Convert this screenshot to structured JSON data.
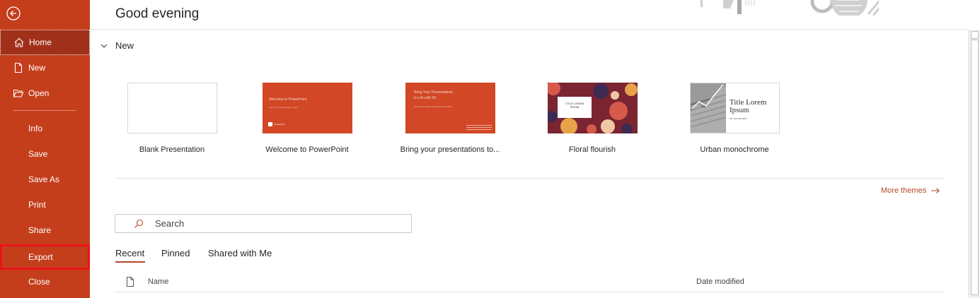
{
  "sidebar": {
    "back_icon": "back-arrow-circle-icon",
    "items": [
      {
        "label": "Home",
        "icon": "home-icon"
      },
      {
        "label": "New",
        "icon": "new-document-icon"
      },
      {
        "label": "Open",
        "icon": "folder-open-icon"
      },
      {
        "label": "Info"
      },
      {
        "label": "Save"
      },
      {
        "label": "Save As"
      },
      {
        "label": "Print"
      },
      {
        "label": "Share"
      },
      {
        "label": "Export"
      },
      {
        "label": "Close"
      }
    ],
    "selected": "Home",
    "highlighted": "Export",
    "colors": {
      "background": "#c43e1c",
      "selected": "#a0301a",
      "highlight_box": "#e8141a"
    }
  },
  "main": {
    "greeting": "Good evening",
    "new_section": {
      "title": "New",
      "templates": [
        {
          "label": "Blank Presentation"
        },
        {
          "label": "Welcome to PowerPoint",
          "thumb_title": "Welcome to PowerPoint",
          "thumb_sub": "5 tips for a simpler way to work",
          "thumb_brand": "PowerPoint"
        },
        {
          "label": "Bring your presentations to...",
          "thumb_title_1": "Bring Your Presentations",
          "thumb_title_2": "to Life with 3D",
          "thumb_sub": "How to get started with 3D in PowerPoint"
        },
        {
          "label": "Floral flourish",
          "thumb_title_1": "TITLE LOREM",
          "thumb_title_2": "IPSUM"
        },
        {
          "label": "Urban monochrome",
          "thumb_title_1": "Title Lorem",
          "thumb_title_2": "Ipsum",
          "thumb_sub": "SIT DOLOR AMET"
        }
      ],
      "more_themes": "More themes"
    },
    "search": {
      "placeholder": "Search",
      "value": ""
    },
    "tabs": [
      {
        "label": "Recent"
      },
      {
        "label": "Pinned"
      },
      {
        "label": "Shared with Me"
      }
    ],
    "active_tab": "Recent",
    "table": {
      "columns": [
        "Name",
        "Date modified"
      ]
    },
    "accent_color": "#b7472a"
  }
}
